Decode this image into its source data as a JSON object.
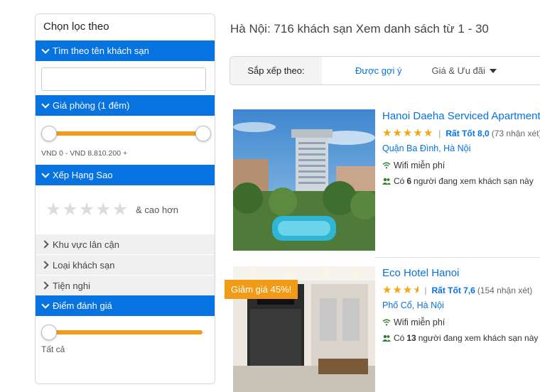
{
  "filters": {
    "title": "Chọn lọc theo",
    "hotel_name": {
      "label": "Tìm theo tên khách sạn",
      "value": "",
      "placeholder": ""
    },
    "price": {
      "label": "Giá phòng (1 đêm)",
      "range_text": "VND 0 - VND 8.810.200 +",
      "min_fraction": 0,
      "max_fraction": 1
    },
    "stars": {
      "label": "Xếp Hạng Sao",
      "suffix": "& cao hơn",
      "count": 5
    },
    "nearby": {
      "label": "Khu vực lân cận"
    },
    "hotel_type": {
      "label": "Loại khách sạn"
    },
    "amenities": {
      "label": "Tiện nghi"
    },
    "review_score": {
      "label": "Điểm đánh giá",
      "value_text": "Tất cả",
      "fraction": 0
    }
  },
  "results": {
    "header": "Hà Nội: 716 khách sạn Xem danh sách từ 1 - 30",
    "sort": {
      "label": "Sắp xếp theo:",
      "recommended": "Được gợi ý",
      "price_deals": "Giá & Ưu đãi"
    },
    "hotels": [
      {
        "name": "Hanoi Daeha Serviced Apartment",
        "stars": 5,
        "separator": "|",
        "rating_text": "Rất Tốt 8,0",
        "reviews_text": "(73 nhận xét)",
        "area": "Quận Ba Đình, Hà Nội",
        "wifi": "Wifi miễn phí",
        "viewers_prefix": "Có",
        "viewers_count": "6",
        "viewers_suffix": "người đang xem khách sạn này"
      },
      {
        "name": "Eco Hotel Hanoi",
        "stars": 3.5,
        "separator": "|",
        "discount": "Giảm giá 45%!",
        "rating_text": "Rất Tốt 7,6",
        "reviews_text": "(154 nhận xét)",
        "area": "Phố Cổ, Hà Nội",
        "wifi": "Wifi miễn phí",
        "viewers_prefix": "Có",
        "viewers_count": "13",
        "viewers_suffix": "người đang xem khách sạn này"
      }
    ]
  },
  "colors": {
    "accent": "#0773e1",
    "slider": "#f29b17",
    "star": "#f2a712",
    "viewer_icon": "#2e7d32"
  },
  "icons": {
    "section_expanded": "chevron-down-icon",
    "section_collapsed": "chevron-right-icon",
    "wifi": "wifi-icon",
    "viewers": "people-icon",
    "sort_caret": "caret-down-icon",
    "star": "star-icon"
  }
}
